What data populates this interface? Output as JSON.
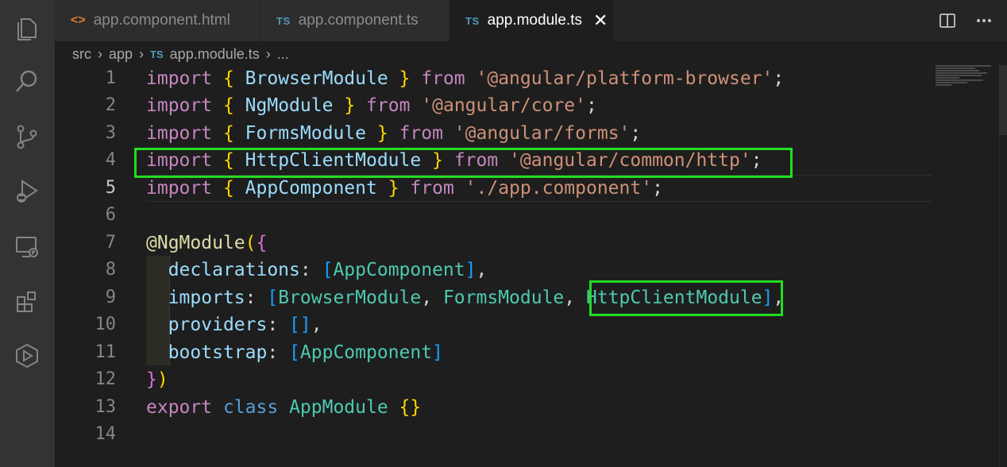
{
  "tabs": [
    {
      "icon": "<>",
      "label": "app.component.html",
      "active": false
    },
    {
      "icon": "TS",
      "label": "app.component.ts",
      "active": false
    },
    {
      "icon": "TS",
      "label": "app.module.ts",
      "active": true
    }
  ],
  "close_glyph": "✕",
  "breadcrumb": {
    "items": [
      "src",
      "app"
    ],
    "file_icon": "TS",
    "file": "app.module.ts",
    "more": "..."
  },
  "line_numbers": [
    "1",
    "2",
    "3",
    "4",
    "5",
    "6",
    "7",
    "8",
    "9",
    "10",
    "11",
    "12",
    "13",
    "14"
  ],
  "active_line": "5",
  "code": {
    "l1": {
      "kw": "import",
      "ob": "{",
      "name": "BrowserModule",
      "cb": "}",
      "from": "from",
      "path": "'@angular/platform-browser'",
      "semi": ";"
    },
    "l2": {
      "kw": "import",
      "ob": "{",
      "name": "NgModule",
      "cb": "}",
      "from": "from",
      "path": "'@angular/core'",
      "semi": ";"
    },
    "l3": {
      "kw": "import",
      "ob": "{",
      "name": "FormsModule",
      "cb": "}",
      "from": "from",
      "path": "'@angular/forms'",
      "semi": ";"
    },
    "l4": {
      "kw": "import",
      "ob": "{",
      "name": "HttpClientModule",
      "cb": "}",
      "from": "from",
      "path": "'@angular/common/http'",
      "semi": ";"
    },
    "l5": {
      "kw": "import",
      "ob": "{",
      "name": "AppComponent",
      "cb": "}",
      "from": "from",
      "path": "'./app.component'",
      "semi": ";"
    },
    "l7": {
      "at": "@",
      "dec": "NgModule",
      "op": "(",
      "ob": "{"
    },
    "l8": {
      "prop": "declarations",
      "colon": ":",
      "ob": "[",
      "v1": "AppComponent",
      "cb": "]",
      "comma": ","
    },
    "l9": {
      "prop": "imports",
      "colon": ":",
      "ob": "[",
      "v1": "BrowserModule",
      "c1": ",",
      "v2": "FormsModule",
      "c2": ",",
      "v3": "HttpClientModule",
      "cb": "]",
      "comma": ","
    },
    "l10": {
      "prop": "providers",
      "colon": ":",
      "ob": "[",
      "cb": "]",
      "comma": ","
    },
    "l11": {
      "prop": "bootstrap",
      "colon": ":",
      "ob": "[",
      "v1": "AppComponent",
      "cb": "]"
    },
    "l12": {
      "cb": "}",
      "cp": ")"
    },
    "l13": {
      "kw": "export",
      "kw2": "class",
      "name": "AppModule",
      "ob": "{",
      "cb": "}"
    }
  },
  "colors": {
    "highlight": "#22dd22",
    "keyword": "#c586c0",
    "string": "#ce9178",
    "identifier": "#9cdcfe",
    "class": "#4ec9b0"
  },
  "activity_icons": [
    "explorer-icon",
    "search-icon",
    "source-control-icon",
    "run-debug-icon",
    "remote-explorer-icon",
    "extensions-icon",
    "live-share-icon"
  ]
}
